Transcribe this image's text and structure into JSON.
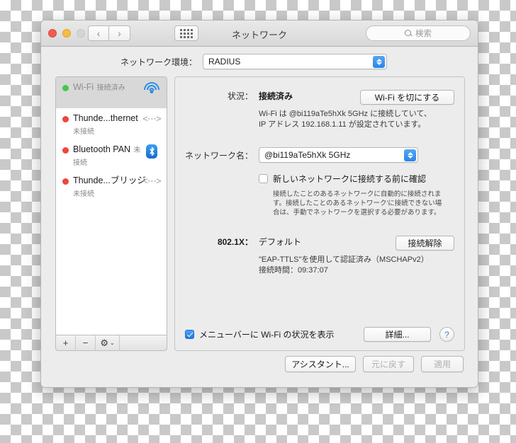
{
  "window": {
    "title": "ネットワーク",
    "traffic_lights": [
      "close",
      "minimize",
      "zoom"
    ],
    "nav_back": "‹",
    "nav_forward": "›"
  },
  "search": {
    "placeholder": "検索"
  },
  "environment": {
    "label": "ネットワーク環境：",
    "value": "RADIUS"
  },
  "sidebar": {
    "services": [
      {
        "name": "Wi-Fi",
        "state": "接続済み",
        "dot": "green",
        "icon": "wifi-icon",
        "selected": true
      },
      {
        "name": "Thunde...thernet",
        "state": "未接続",
        "dot": "red",
        "icon": "thunderbolt-icon",
        "selected": false
      },
      {
        "name": "Bluetooth PAN",
        "state": "未接続",
        "dot": "red",
        "icon": "bluetooth-icon",
        "selected": false
      },
      {
        "name": "Thunde...ブリッジ",
        "state": "未接続",
        "dot": "red",
        "icon": "thunderbolt-icon",
        "selected": false
      }
    ],
    "footer": {
      "add": "+",
      "remove": "−",
      "gear": "⚙",
      "gear_chevron": "⌄"
    }
  },
  "panel": {
    "status": {
      "label": "状況：",
      "value": "接続済み",
      "detail_line1": "Wi-Fi は @bi119aTe5hXk 5GHz に接続していて、",
      "detail_line2": "IP アドレス 192.168.1.11 が設定されています。",
      "toggle_button": "Wi-Fi を切にする"
    },
    "network_name": {
      "label": "ネットワーク名：",
      "value": "@bi119aTe5hXk 5GHz"
    },
    "ask_to_join": {
      "label": "新しいネットワークに接続する前に確認",
      "checked": false,
      "help_line1": "接続したことのあるネットワークに自動的に接続されま",
      "help_line2": "す。接続したことのあるネットワーク'に接続できない場",
      "help_line3": "合は、手動でネットワークを選択する必要があります。"
    },
    "dot1x": {
      "label": "802.1X：",
      "value": "デフォルト",
      "detail_line1": "\"EAP-TTLS\"を使用して認証済み（MSCHAPv2）",
      "detail_line2": "接続時間：09:37:07",
      "disconnect_button": "接続解除"
    },
    "menubar": {
      "label": "メニューバーに Wi-Fi の状況を表示",
      "checked": true
    },
    "advanced_button": "詳細...",
    "help_button": "?"
  },
  "bottom": {
    "assistant_button": "アシスタント...",
    "revert_button": "元に戻す",
    "apply_button": "適用",
    "revert_disabled": true,
    "apply_disabled": true
  },
  "colors": {
    "accent_blue": "#2b84e8",
    "status_connected": "#45c84b",
    "status_disconnected": "#f0453b"
  }
}
